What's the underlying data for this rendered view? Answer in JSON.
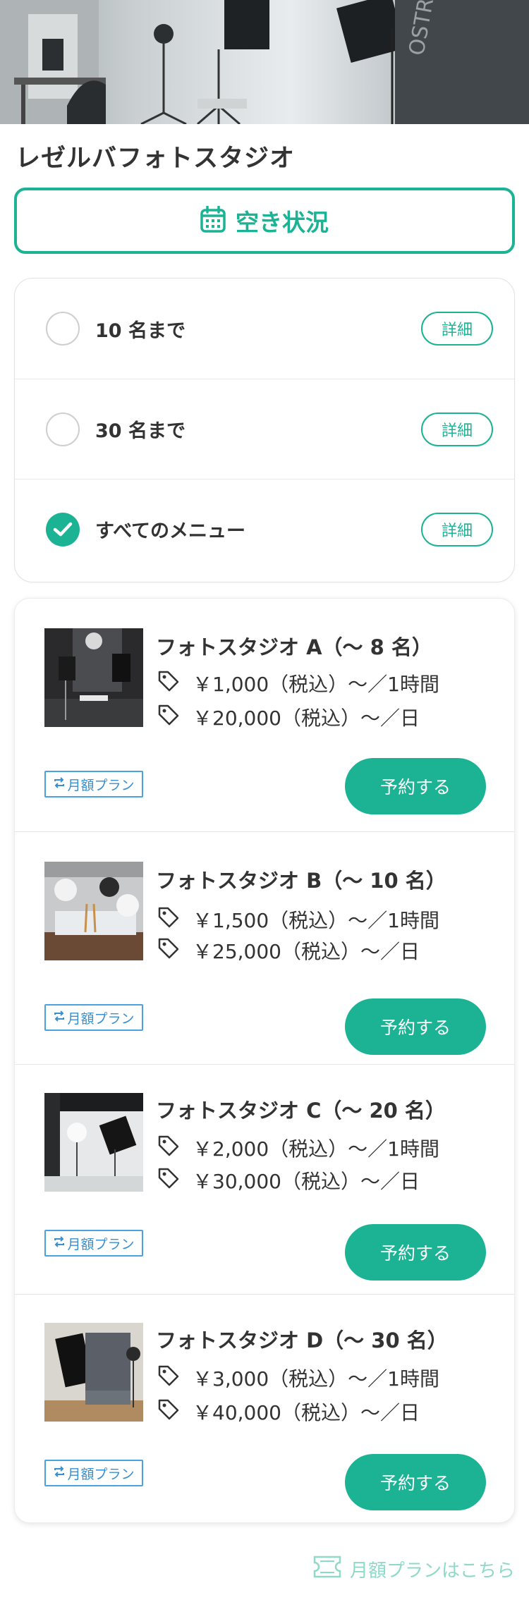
{
  "studio": {
    "name": "レゼルバフォトスタジオ"
  },
  "availability_button": {
    "label": "空き状況",
    "icon": "calendar-icon"
  },
  "filters": [
    {
      "label": "10 名まで",
      "detail_label": "詳細",
      "selected": false
    },
    {
      "label": "30 名まで",
      "detail_label": "詳細",
      "selected": false
    },
    {
      "label": "すべてのメニュー",
      "detail_label": "詳細",
      "selected": true
    }
  ],
  "menu_items": [
    {
      "name": "フォトスタジオ A（〜 8 名）",
      "price_hour": "￥1,000（税込）〜／1時間",
      "price_day": "￥20,000（税込）〜／日",
      "badge": "月額プラン",
      "reserve_label": "予約する"
    },
    {
      "name": "フォトスタジオ B（〜 10 名）",
      "price_hour": "￥1,500（税込）〜／1時間",
      "price_day": "￥25,000（税込）〜／日",
      "badge": "月額プラン",
      "reserve_label": "予約する"
    },
    {
      "name": "フォトスタジオ C（〜 20 名）",
      "price_hour": "￥2,000（税込）〜／1時間",
      "price_day": "￥30,000（税込）〜／日",
      "badge": "月額プラン",
      "reserve_label": "予約する"
    },
    {
      "name": "フォトスタジオ D（〜 30 名）",
      "price_hour": "￥3,000（税込）〜／1時間",
      "price_day": "￥40,000（税込）〜／日",
      "badge": "月額プラン",
      "reserve_label": "予約する"
    }
  ],
  "footer": {
    "monthly_link": "月額プランはこちら",
    "icon": "ticket-icon"
  },
  "colors": {
    "accent": "#1bb394",
    "badge_blue": "#3a8fd0",
    "link_light": "#8fd9c8",
    "text": "#333333"
  }
}
